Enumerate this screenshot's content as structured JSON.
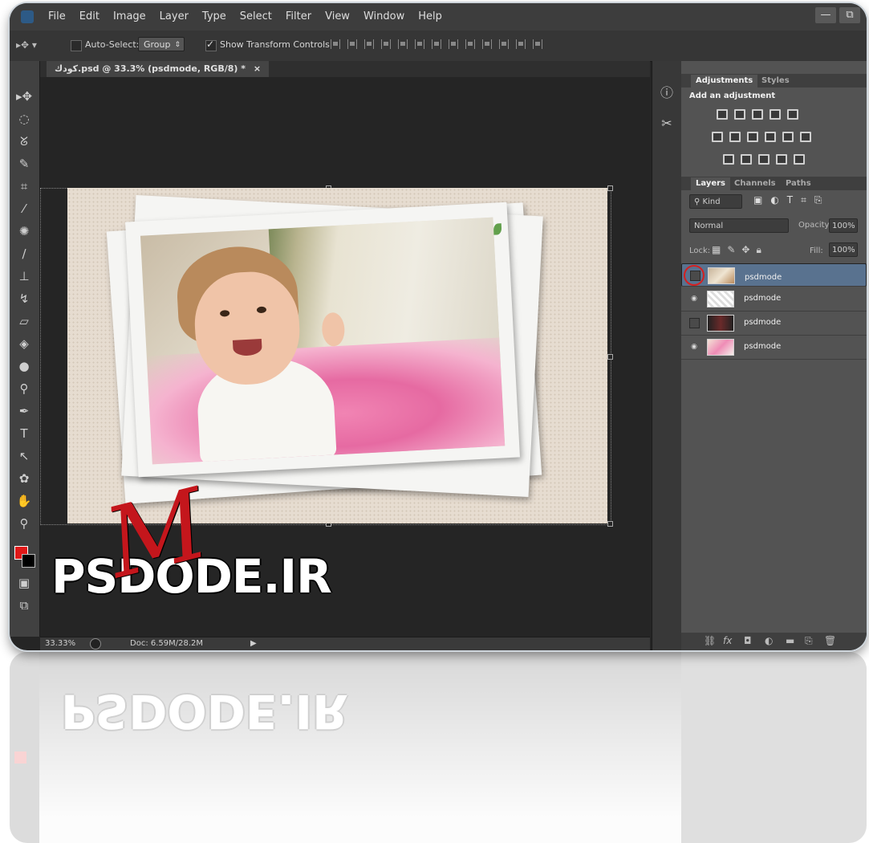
{
  "app": {
    "menu": [
      "File",
      "Edit",
      "Image",
      "Layer",
      "Type",
      "Select",
      "Filter",
      "View",
      "Window",
      "Help"
    ],
    "window_buttons": [
      "—",
      "⧉"
    ]
  },
  "options_bar": {
    "auto_select_label": "Auto-Select:",
    "auto_select_target": "Group",
    "show_transform_label": "Show Transform Controls",
    "auto_select_checked": false,
    "show_transform_checked": true
  },
  "document": {
    "tab_title": "كودك.psd @ 33.3% (psdmode, RGB/8) *",
    "close_glyph": "×"
  },
  "status": {
    "zoom": "33.33%",
    "doc_size": "Doc: 6.59M/28.2M",
    "arrow": "▶"
  },
  "adjustments_panel": {
    "tabs": [
      "Adjustments",
      "Styles"
    ],
    "heading": "Add an adjustment"
  },
  "layers_panel": {
    "tabs": [
      "Layers",
      "Channels",
      "Paths"
    ],
    "filter_kind": "Kind",
    "blend_mode": "Normal",
    "opacity_label": "Opacity:",
    "opacity_value": "100%",
    "lock_label": "Lock:",
    "fill_label": "Fill:",
    "fill_value": "100%",
    "layers": [
      {
        "name": "psdmode",
        "visible": false,
        "selected": true
      },
      {
        "name": "psdmode",
        "visible": true,
        "selected": false
      },
      {
        "name": "psdmode",
        "visible": false,
        "selected": false
      },
      {
        "name": "psdmode",
        "visible": true,
        "selected": false
      }
    ]
  },
  "watermark": {
    "text": "PSDODE.IR",
    "script_letter": "M"
  },
  "colors": {
    "foreground": "#e01818",
    "background": "#000000",
    "selected_layer": "#59728f",
    "highlight_circle": "#d42020"
  }
}
